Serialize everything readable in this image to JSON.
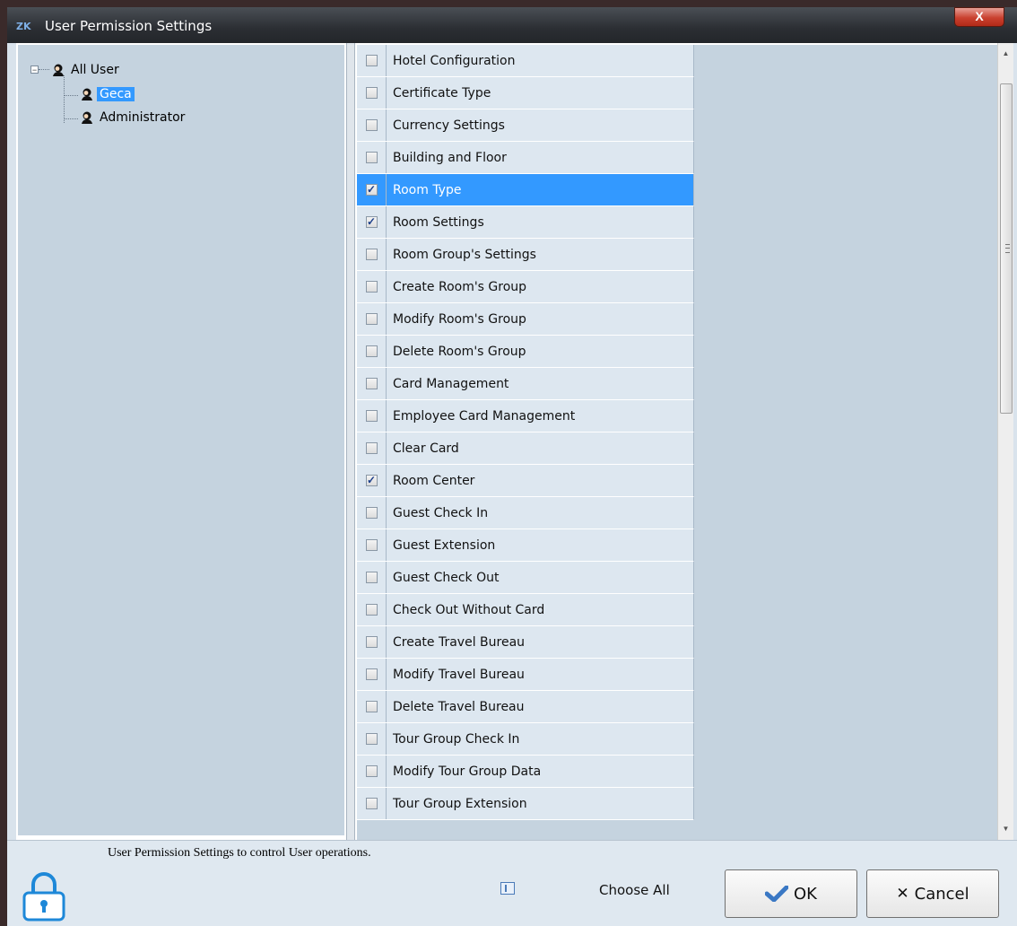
{
  "window": {
    "title": "User Permission Settings",
    "app_badge": "ZK",
    "close_label": "X"
  },
  "tree": {
    "root": {
      "label": "All User",
      "expander": "−"
    },
    "children": [
      {
        "label": "Geca",
        "selected": true
      },
      {
        "label": "Administrator",
        "selected": false
      }
    ]
  },
  "permissions": [
    {
      "label": "Hotel Configuration",
      "checked": false
    },
    {
      "label": "Certificate Type",
      "checked": false
    },
    {
      "label": "Currency Settings",
      "checked": false
    },
    {
      "label": "Building and Floor",
      "checked": false
    },
    {
      "label": "Room Type",
      "checked": true,
      "selected": true
    },
    {
      "label": "Room Settings",
      "checked": true
    },
    {
      "label": "Room Group's Settings",
      "checked": false
    },
    {
      "label": "Create Room's Group",
      "checked": false
    },
    {
      "label": "Modify Room's Group",
      "checked": false
    },
    {
      "label": "Delete Room's Group",
      "checked": false
    },
    {
      "label": "Card Management",
      "checked": false
    },
    {
      "label": "Employee Card Management",
      "checked": false
    },
    {
      "label": "Clear Card",
      "checked": false
    },
    {
      "label": "Room Center",
      "checked": true
    },
    {
      "label": "Guest Check In",
      "checked": false
    },
    {
      "label": "Guest Extension",
      "checked": false
    },
    {
      "label": "Guest Check Out",
      "checked": false
    },
    {
      "label": "Check Out Without Card",
      "checked": false
    },
    {
      "label": "Create Travel Bureau",
      "checked": false
    },
    {
      "label": "Modify Travel Bureau",
      "checked": false
    },
    {
      "label": "Delete Travel Bureau",
      "checked": false
    },
    {
      "label": "Tour Group Check In",
      "checked": false
    },
    {
      "label": "Modify Tour Group Data",
      "checked": false
    },
    {
      "label": "Tour Group Extension",
      "checked": false
    }
  ],
  "footer": {
    "description": "User Permission Settings to control User operations.",
    "choose_all_label": "Choose All",
    "ok_label": "OK",
    "cancel_label": "Cancel"
  },
  "colors": {
    "selection": "#3399ff",
    "panel": "#c5d3df",
    "close": "#c9402e"
  }
}
